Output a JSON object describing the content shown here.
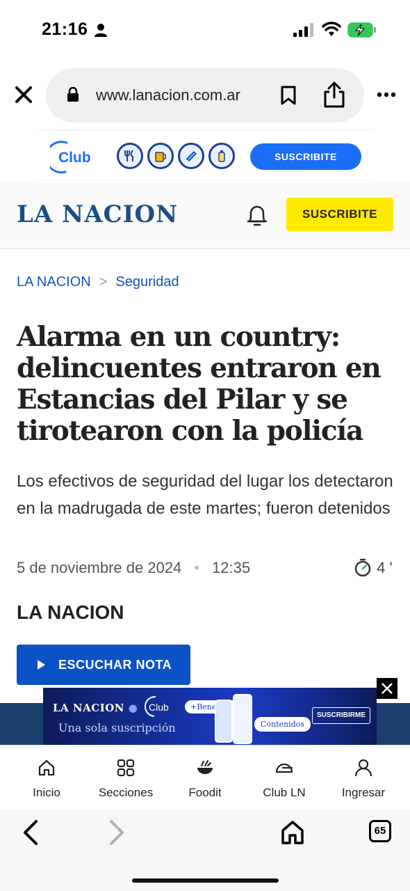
{
  "status_bar": {
    "time": "21:16"
  },
  "browser": {
    "url": "www.lanacion.com.ar",
    "tab_count": "65"
  },
  "top_ad": {
    "club_logo": "Club",
    "cta": "SUSCRIBITE"
  },
  "header": {
    "logo": "LA NACION",
    "subscribe": "SUSCRIBITE"
  },
  "breadcrumb": {
    "home": "LA NACION",
    "separator": ">",
    "section": "Seguridad"
  },
  "article": {
    "headline": "Alarma en un country: delincuentes entraron en Estancias del Pilar y se tirotearon con la policía",
    "subheadline": "Los efectivos de seguridad del lugar los detectaron en la madrugada de este martes; fueron detenidos",
    "date": "5 de noviembre de 2024",
    "meta_dot": "•",
    "time": "12:35",
    "read_time": "4 '",
    "author": "LA NACION",
    "listen_label": "ESCUCHAR NOTA"
  },
  "bottom_ad": {
    "brand": "LA NACION",
    "club": "Club",
    "tagline": "Una sola suscripción",
    "beneficios": "+Beneficios",
    "contenidos": "Contenidos",
    "cta": "SUSCRIBIRME"
  },
  "nav": {
    "items": [
      {
        "label": "Inicio",
        "icon": "home-icon"
      },
      {
        "label": "Secciones",
        "icon": "grid-icon"
      },
      {
        "label": "Foodit",
        "icon": "food-bowl-icon"
      },
      {
        "label": "Club LN",
        "icon": "club-icon"
      },
      {
        "label": "Ingresar",
        "icon": "user-icon"
      }
    ]
  }
}
